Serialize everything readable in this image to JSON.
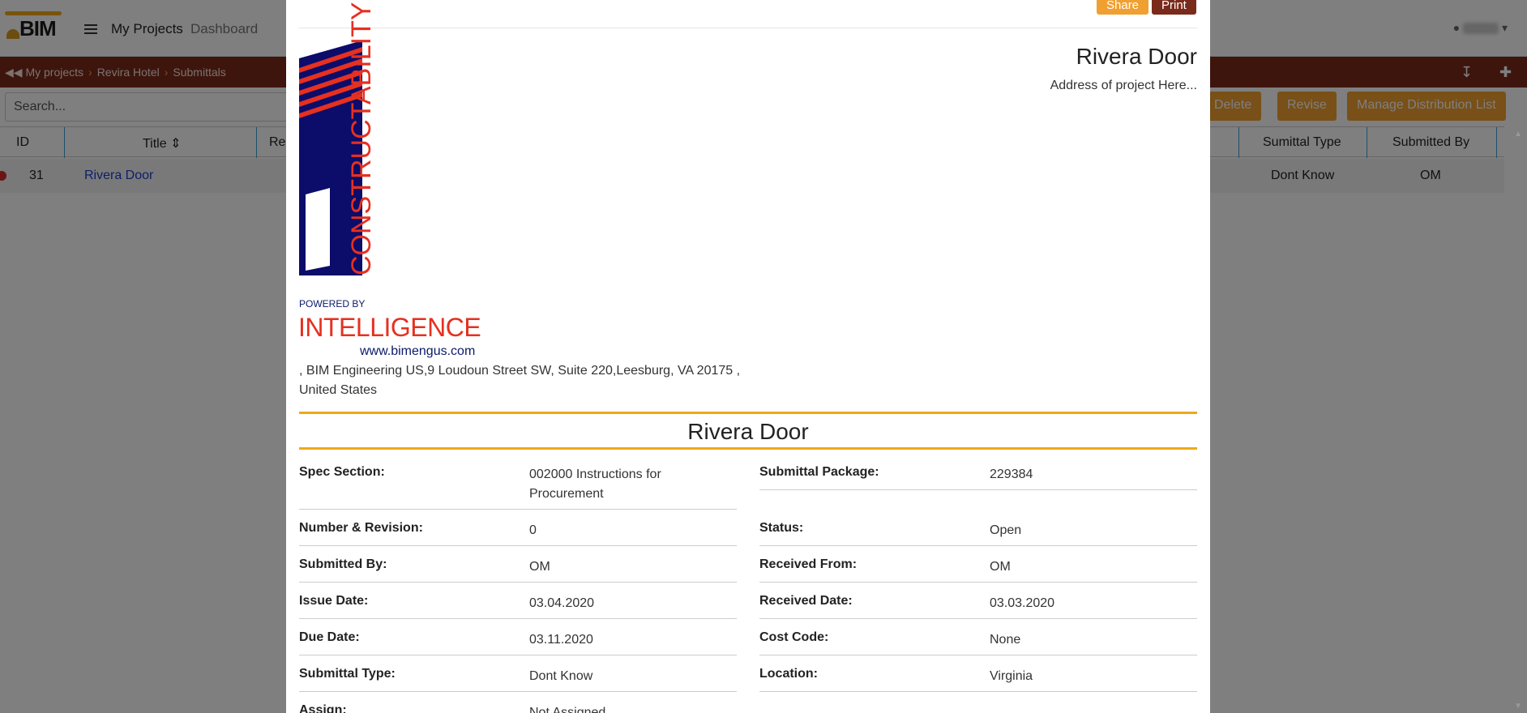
{
  "app": {
    "brand": "BIM",
    "nav": {
      "my_projects": "My Projects",
      "dashboard": "Dashboard"
    },
    "breadcrumb": [
      "My projects",
      "Revira Hotel",
      "Submittals"
    ],
    "search_placeholder": "Search...",
    "actions": {
      "delete": "Delete",
      "revise": "Revise",
      "manage_distribution": "Manage Distribution List"
    },
    "table": {
      "headers": {
        "id": "ID",
        "title": "Title",
        "res": "Res",
        "submittal_type": "Sumittal Type",
        "submitted_by": "Submitted By"
      },
      "sort_icon": "sort-icon",
      "row": {
        "id": "31",
        "title": "Rivera Door",
        "submittal_type": "Dont Know",
        "submitted_by": "OM"
      }
    },
    "colors": {
      "accent": "#f0a030",
      "bar": "#7a2a1a",
      "status_dot": "#d62828",
      "link": "#1a3fd0"
    }
  },
  "modal": {
    "share_label": "Share",
    "print_label": "Print",
    "logo": {
      "word": "CONSTRUCTABILITY",
      "powered_by": "POWERED BY",
      "intelligence": "INTELLIGENCE",
      "website": "www.bimengus.com"
    },
    "company_address": ", BIM Engineering US,9 Loudoun Street SW, Suite 220,Leesburg, VA 20175 , United States",
    "project_title": "Rivera Door",
    "project_address": "Address of project Here...",
    "section_title": "Rivera Door",
    "left_fields": [
      {
        "label": "Spec Section:",
        "value": "002000 Instructions for Procurement"
      },
      {
        "label": "Number & Revision:",
        "value": "0"
      },
      {
        "label": "Submitted By:",
        "value": "OM"
      },
      {
        "label": "Issue Date:",
        "value": "03.04.2020"
      },
      {
        "label": "Due Date:",
        "value": "03.11.2020"
      },
      {
        "label": "Submittal Type:",
        "value": "Dont Know"
      },
      {
        "label": "Assign:",
        "value": "Not Assigned"
      }
    ],
    "right_fields": [
      {
        "label": "Submittal Package:",
        "value": "229384"
      },
      {
        "label": "Status:",
        "value": "Open"
      },
      {
        "label": "Received From:",
        "value": "OM"
      },
      {
        "label": "Received Date:",
        "value": "03.03.2020"
      },
      {
        "label": "Cost Code:",
        "value": "None"
      },
      {
        "label": "Location:",
        "value": "Virginia"
      }
    ]
  }
}
